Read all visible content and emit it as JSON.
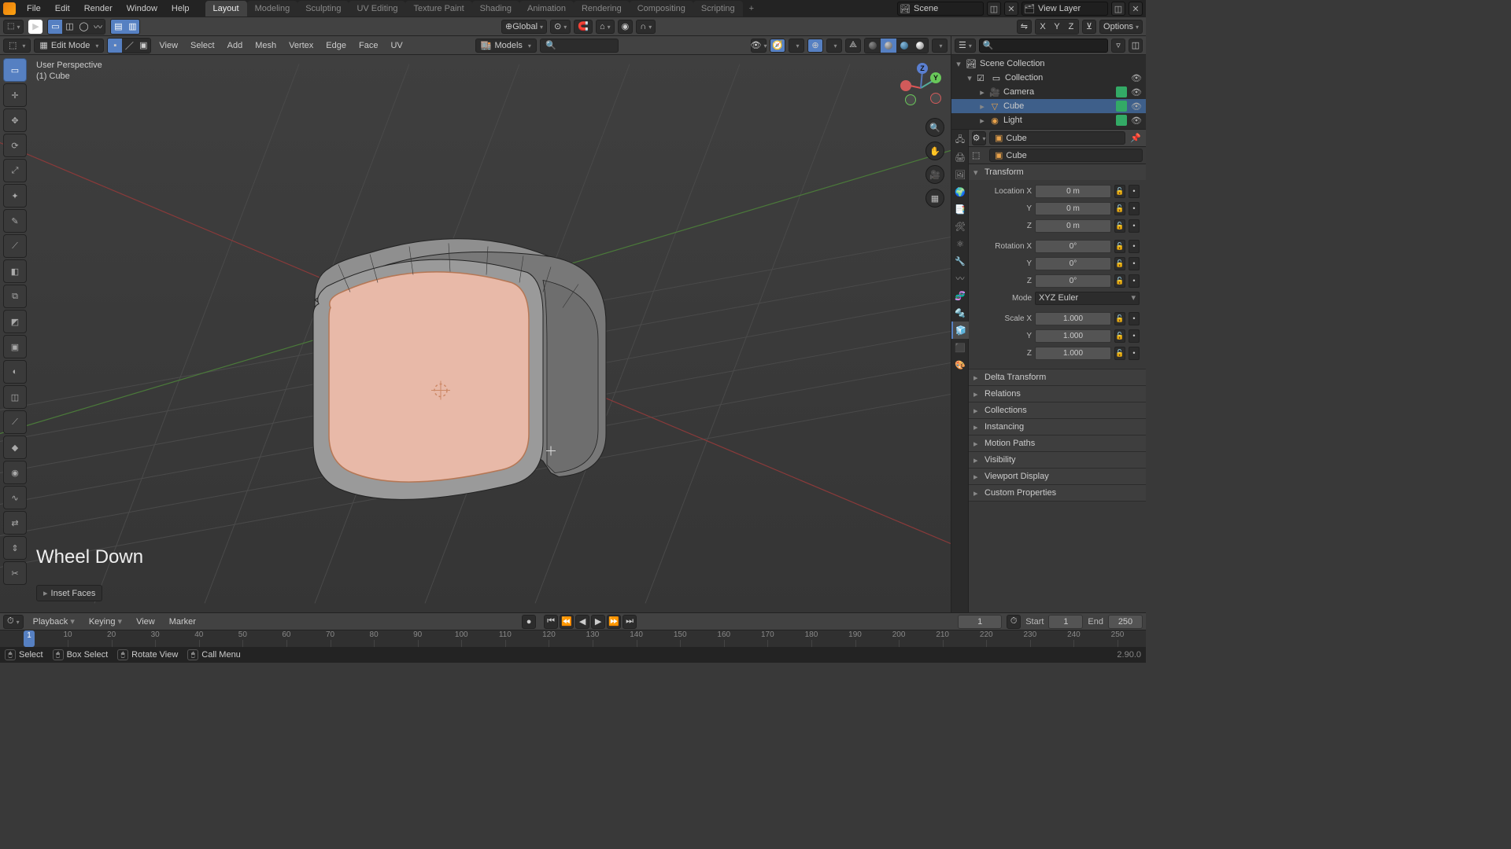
{
  "menubar": {
    "menus": [
      "File",
      "Edit",
      "Render",
      "Window",
      "Help"
    ],
    "tabs": [
      "Layout",
      "Modeling",
      "Sculpting",
      "UV Editing",
      "Texture Paint",
      "Shading",
      "Animation",
      "Rendering",
      "Compositing",
      "Scripting"
    ],
    "active_tab": 0,
    "scene_label": "Scene",
    "viewlayer_label": "View Layer"
  },
  "wsheader": {
    "orientation": "Global",
    "snap_targets": "⌂",
    "options_label": "Options"
  },
  "vpheader": {
    "mode": "Edit Mode",
    "menus": [
      "View",
      "Select",
      "Add",
      "Mesh",
      "Vertex",
      "Edge",
      "Face",
      "UV"
    ],
    "collection": "Models"
  },
  "overlay": {
    "line1": "User Perspective",
    "line2": "(1) Cube",
    "keycast": "Wheel Down",
    "last_op": "Inset Faces"
  },
  "toolbar": {
    "tools": [
      {
        "name": "select-box",
        "icon": "▭",
        "active": true
      },
      {
        "name": "cursor",
        "icon": "✛"
      },
      {
        "name": "move",
        "icon": "✥"
      },
      {
        "name": "rotate",
        "icon": "⟳"
      },
      {
        "name": "scale",
        "icon": "⤢"
      },
      {
        "name": "transform",
        "icon": "✦"
      },
      {
        "name": "annotate",
        "icon": "✎"
      },
      {
        "name": "measure",
        "icon": "⟋"
      },
      {
        "name": "add-cube",
        "icon": "◧"
      },
      {
        "name": "extrude-region",
        "icon": "⧉"
      },
      {
        "name": "extrude-manifold",
        "icon": "◩"
      },
      {
        "name": "inset-faces",
        "icon": "▣"
      },
      {
        "name": "bevel",
        "icon": "◐"
      },
      {
        "name": "loop-cut",
        "icon": "◫"
      },
      {
        "name": "knife",
        "icon": "⟋"
      },
      {
        "name": "poly-build",
        "icon": "◆"
      },
      {
        "name": "spin",
        "icon": "◉"
      },
      {
        "name": "smooth",
        "icon": "∿"
      },
      {
        "name": "edge-slide",
        "icon": "⇄"
      },
      {
        "name": "shrink-fatten",
        "icon": "⇕"
      },
      {
        "name": "rip-region",
        "icon": "✂"
      }
    ]
  },
  "gizmo_stack": [
    {
      "name": "zoom",
      "icon": "🔍"
    },
    {
      "name": "pan",
      "icon": "✋"
    },
    {
      "name": "camera-view",
      "icon": "🎥"
    },
    {
      "name": "toggle-ortho",
      "icon": "▦"
    }
  ],
  "outliner": {
    "root": "Scene Collection",
    "collection": "Collection",
    "items": [
      {
        "name": "Camera",
        "icon": "🎥",
        "selected": false,
        "color": "#5fbf8f"
      },
      {
        "name": "Cube",
        "icon": "▽",
        "selected": true,
        "color": "#e8a24b"
      },
      {
        "name": "Light",
        "icon": "◉",
        "selected": false,
        "color": "#e8a24b"
      }
    ]
  },
  "properties": {
    "object_name": "Cube",
    "data_name": "Cube",
    "panels_closed": [
      "Delta Transform",
      "Relations",
      "Collections",
      "Instancing",
      "Motion Paths",
      "Visibility",
      "Viewport Display",
      "Custom Properties"
    ],
    "transform": {
      "title": "Transform",
      "loc_label": "Location X",
      "loc": [
        "0 m",
        "0 m",
        "0 m"
      ],
      "rot_label": "Rotation X",
      "rot": [
        "0°",
        "0°",
        "0°"
      ],
      "mode_label": "Mode",
      "mode_value": "XYZ Euler",
      "scale_label": "Scale X",
      "scale": [
        "1.000",
        "1.000",
        "1.000"
      ],
      "yz": [
        "Y",
        "Z"
      ]
    },
    "tab_icons": [
      "🖧",
      "🖨",
      "🖼",
      "🌍",
      "📑",
      "🛠",
      "⚛",
      "🔧",
      "〰",
      "🧬",
      "🔩",
      "🧊",
      "⬛",
      "🎨"
    ]
  },
  "timeline": {
    "menus": [
      "Playback",
      "Keying",
      "View",
      "Marker"
    ],
    "current_frame": "1",
    "start_label": "Start",
    "start": "1",
    "end_label": "End",
    "end": "250",
    "ticks": [
      1,
      10,
      20,
      30,
      40,
      50,
      60,
      70,
      80,
      90,
      100,
      110,
      120,
      130,
      140,
      150,
      160,
      170,
      180,
      190,
      200,
      210,
      220,
      230,
      240,
      250
    ]
  },
  "statusbar": {
    "items": [
      {
        "icon": "▭",
        "label": "Select"
      },
      {
        "icon": "◫",
        "label": "Box Select"
      },
      {
        "icon": "⟳",
        "label": "Rotate View"
      },
      {
        "icon": "≡",
        "label": "Call Menu"
      }
    ],
    "version": "2.90.0"
  }
}
